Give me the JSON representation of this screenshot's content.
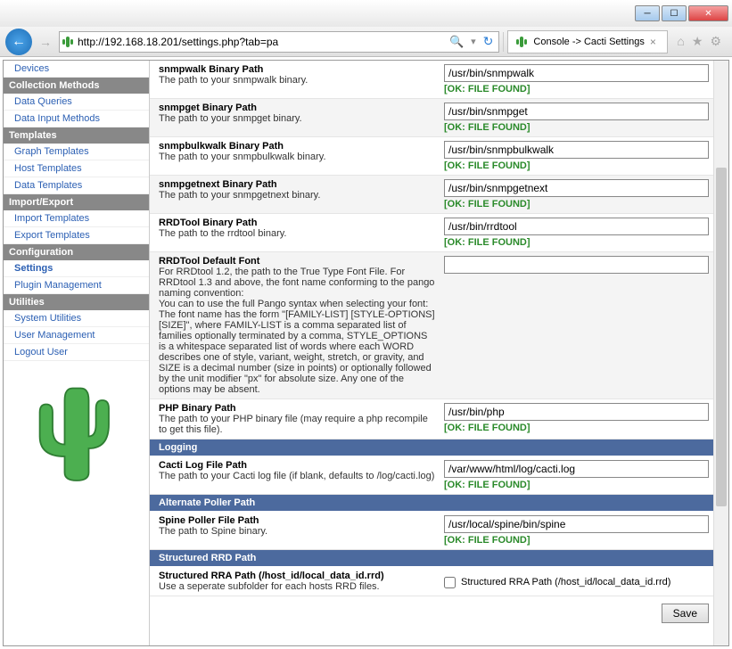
{
  "browser": {
    "url": "http://192.168.18.201/settings.php?tab=pa",
    "tab_title": "Console -> Cacti Settings"
  },
  "sidebar": {
    "groups": [
      {
        "header": null,
        "items": [
          "Devices"
        ]
      },
      {
        "header": "Collection Methods",
        "items": [
          "Data Queries",
          "Data Input Methods"
        ]
      },
      {
        "header": "Templates",
        "items": [
          "Graph Templates",
          "Host Templates",
          "Data Templates"
        ]
      },
      {
        "header": "Import/Export",
        "items": [
          "Import Templates",
          "Export Templates"
        ]
      },
      {
        "header": "Configuration",
        "items": [
          "Settings",
          "Plugin Management"
        ]
      },
      {
        "header": "Utilities",
        "items": [
          "System Utilities",
          "User Management",
          "Logout User"
        ]
      }
    ],
    "active": "Settings"
  },
  "settings": [
    {
      "label": "snmpwalk Binary Path",
      "desc": "The path to your snmpwalk binary.",
      "value": "/usr/bin/snmpwalk",
      "status": "[OK: FILE FOUND]",
      "alt": false
    },
    {
      "label": "snmpget Binary Path",
      "desc": "The path to your snmpget binary.",
      "value": "/usr/bin/snmpget",
      "status": "[OK: FILE FOUND]",
      "alt": true
    },
    {
      "label": "snmpbulkwalk Binary Path",
      "desc": "The path to your snmpbulkwalk binary.",
      "value": "/usr/bin/snmpbulkwalk",
      "status": "[OK: FILE FOUND]",
      "alt": false
    },
    {
      "label": "snmpgetnext Binary Path",
      "desc": "The path to your snmpgetnext binary.",
      "value": "/usr/bin/snmpgetnext",
      "status": "[OK: FILE FOUND]",
      "alt": true
    },
    {
      "label": "RRDTool Binary Path",
      "desc": "The path to the rrdtool binary.",
      "value": "/usr/bin/rrdtool",
      "status": "[OK: FILE FOUND]",
      "alt": false
    },
    {
      "label": "RRDTool Default Font",
      "desc": "For RRDtool 1.2, the path to the True Type Font File. For RRDtool 1.3 and above, the font name conforming to the pango naming convention:\nYou can to use the full Pango syntax when selecting your font: The font name has the form \"[FAMILY-LIST] [STYLE-OPTIONS] [SIZE]\", where FAMILY-LIST is a comma separated list of families optionally terminated by a comma, STYLE_OPTIONS is a whitespace separated list of words where each WORD describes one of style, variant, weight, stretch, or gravity, and SIZE is a decimal number (size in points) or optionally followed by the unit modifier \"px\" for absolute size. Any one of the options may be absent.",
      "value": "",
      "status": null,
      "alt": true
    },
    {
      "label": "PHP Binary Path",
      "desc": "The path to your PHP binary file (may require a php recompile to get this file).",
      "value": "/usr/bin/php",
      "status": "[OK: FILE FOUND]",
      "alt": false
    }
  ],
  "sections": {
    "logging": {
      "header": "Logging",
      "items": [
        {
          "label": "Cacti Log File Path",
          "desc": "The path to your Cacti log file (if blank, defaults to /log/cacti.log)",
          "value": "/var/www/html/log/cacti.log",
          "status": "[OK: FILE FOUND]",
          "alt": false
        }
      ]
    },
    "poller": {
      "header": "Alternate Poller Path",
      "items": [
        {
          "label": "Spine Poller File Path",
          "desc": "The path to Spine binary.",
          "value": "/usr/local/spine/bin/spine",
          "status": "[OK: FILE FOUND]",
          "alt": false
        }
      ]
    },
    "rrd": {
      "header": "Structured RRD Path",
      "checkbox": {
        "label": "Structured RRA Path (/host_id/local_data_id.rrd)",
        "desc": "Use a seperate subfolder for each hosts RRD files.",
        "cb_label": "Structured RRA Path (/host_id/local_data_id.rrd)"
      }
    }
  },
  "buttons": {
    "save": "Save"
  }
}
